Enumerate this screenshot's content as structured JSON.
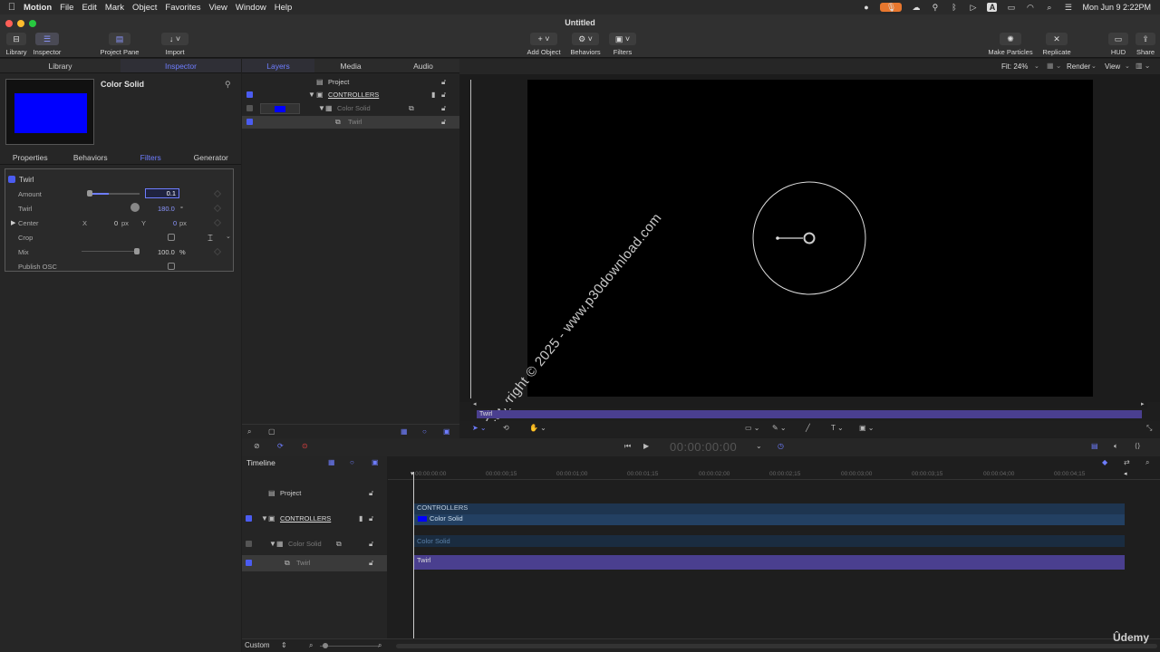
{
  "menubar": {
    "app": "Motion",
    "items": [
      "File",
      "Edit",
      "Mark",
      "Object",
      "Favorites",
      "View",
      "Window",
      "Help"
    ],
    "clock": "Mon Jun 9  2:22PM",
    "input_label": "A"
  },
  "window": {
    "title": "Untitled"
  },
  "toolbar": {
    "library": "Library",
    "inspector": "Inspector",
    "project_pane": "Project Pane",
    "import": "Import",
    "add_object": "Add Object",
    "behaviors": "Behaviors",
    "filters": "Filters",
    "make_particles": "Make Particles",
    "replicate": "Replicate",
    "hud": "HUD",
    "share": "Share"
  },
  "left_tabs": [
    "Library",
    "Inspector"
  ],
  "preview": {
    "title": "Color Solid",
    "color": "#0000ff"
  },
  "inspector_tabs": [
    "Properties",
    "Behaviors",
    "Filters",
    "Generator"
  ],
  "filter": {
    "name": "Twirl",
    "amount_label": "Amount",
    "amount_value": "0.1",
    "twirl_label": "Twirl",
    "twirl_value": "180.0",
    "twirl_unit": "°",
    "center_label": "Center",
    "center_x_label": "X",
    "center_x": "0",
    "center_x_unit": "px",
    "center_y_label": "Y",
    "center_y": "0",
    "center_y_unit": "px",
    "crop_label": "Crop",
    "mix_label": "Mix",
    "mix_value": "100.0",
    "mix_unit": "%",
    "publish_label": "Publish OSC"
  },
  "layers_tabs": [
    "Layers",
    "Media",
    "Audio"
  ],
  "layers": {
    "project": "Project",
    "controllers": "CONTROLLERS",
    "color_solid": "Color Solid",
    "twirl": "Twirl"
  },
  "canvas_header": {
    "fit": "Fit: 24%",
    "render": "Render",
    "view": "View"
  },
  "canvas": {
    "watermark": "Copyright © 2025 - www.p30download.com",
    "mini_label": "Twirl"
  },
  "transport": {
    "timecode": "00:00:00:00"
  },
  "timeline": {
    "title": "Timeline",
    "rows": {
      "project": "Project",
      "controllers": "CONTROLLERS",
      "color_solid": "Color Solid",
      "twirl": "Twirl"
    },
    "ruler": [
      "00:00:00:00",
      "00:00:00;15",
      "00:00:01;00",
      "00:00:01;15",
      "00:00:02;00",
      "00:00:02;15",
      "00:00:03;00",
      "00:00:03;15",
      "00:00:04;00",
      "00:00:04;15"
    ],
    "bars": {
      "controllers": "CONTROLLERS",
      "color_solid_inner": "Color Solid",
      "color_solid": "Color Solid",
      "twirl": "Twirl"
    },
    "footer": "Custom"
  },
  "brand": "Ûdemy",
  "colors": {
    "accent": "#6e7dff",
    "bar_controllers": "#1e3550",
    "bar_twirl": "#4a3f8f"
  }
}
